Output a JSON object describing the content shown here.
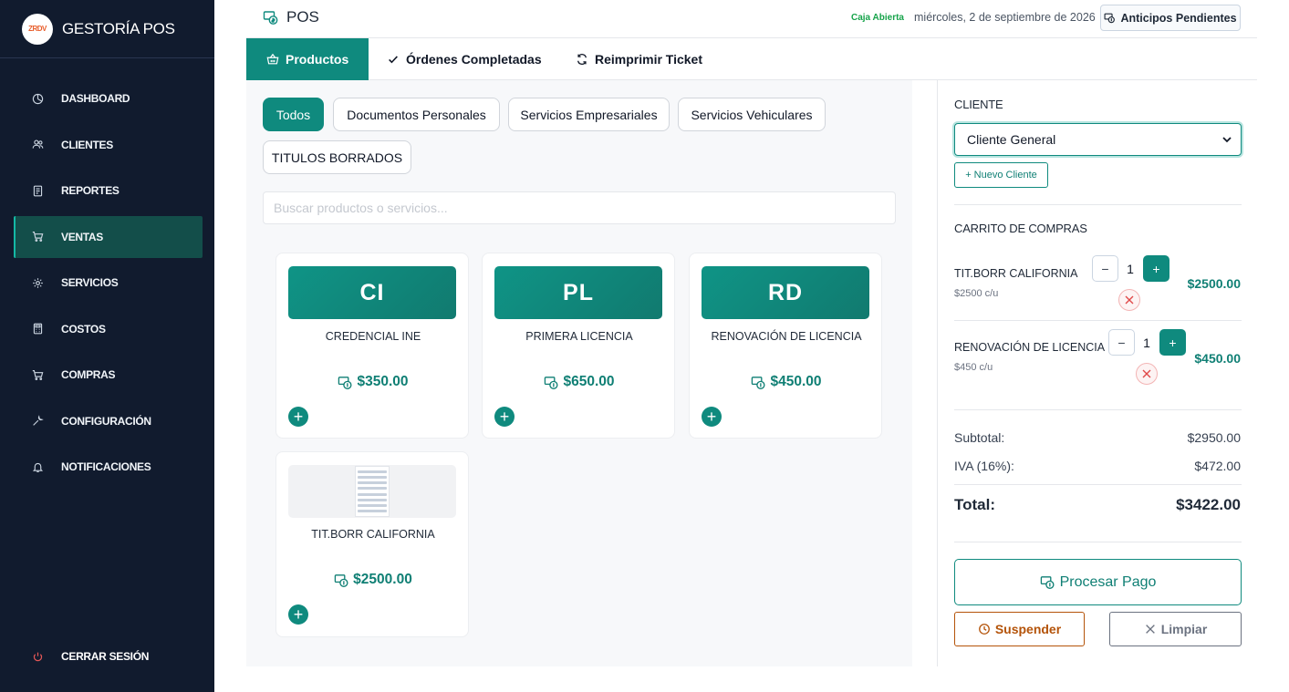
{
  "sidebar": {
    "brand": "GESTORÍA POS",
    "logo_text": "ZRDV",
    "items": [
      {
        "label": "DASHBOARD",
        "icon": "dashboard-icon"
      },
      {
        "label": "CLIENTES",
        "icon": "users-icon"
      },
      {
        "label": "REPORTES",
        "icon": "report-icon"
      },
      {
        "label": "VENTAS",
        "icon": "cart-icon",
        "active": true
      },
      {
        "label": "SERVICIOS",
        "icon": "gear-icon"
      },
      {
        "label": "COSTOS",
        "icon": "calculator-icon"
      },
      {
        "label": "COMPRAS",
        "icon": "cart-icon"
      },
      {
        "label": "CONFIGURACIÓN",
        "icon": "wrench-icon"
      },
      {
        "label": "NOTIFICACIONES",
        "icon": "bell-icon"
      }
    ],
    "logout": "CERRAR SESIÓN"
  },
  "topbar": {
    "title": "POS",
    "status": "Caja Abierta",
    "date": "miércoles, 2 de septiembre de 2026",
    "anticipos": "Anticipos Pendientes"
  },
  "tabs": [
    "Productos",
    "Órdenes Completadas",
    "Reimprimir Ticket"
  ],
  "filters": [
    "Todos",
    "Documentos Personales",
    "Servicios Empresariales",
    "Servicios Vehiculares",
    "TITULOS BORRADOS"
  ],
  "search": {
    "placeholder": "Buscar productos o servicios..."
  },
  "products": [
    {
      "code": "CI",
      "name": "CREDENCIAL INE",
      "price": "$350.00"
    },
    {
      "code": "PL",
      "name": "PRIMERA LICENCIA",
      "price": "$650.00"
    },
    {
      "code": "RD",
      "name": "RENOVACIÓN DE LICENCIA",
      "price": "$450.00"
    },
    {
      "code": "",
      "name": "TIT.BORR CALIFORNIA",
      "price": "$2500.00"
    }
  ],
  "client": {
    "label": "CLIENTE",
    "selected": "Cliente General",
    "new_button": "+ Nuevo Cliente"
  },
  "cart": {
    "label": "CARRITO DE COMPRAS",
    "items": [
      {
        "name": "TIT.BORR CALIFORNIA",
        "unit": "$2500 c/u",
        "qty": "1",
        "total": "$2500.00"
      },
      {
        "name": "RENOVACIÓN DE LICENCIA",
        "unit": "$450 c/u",
        "qty": "1",
        "total": "$450.00"
      }
    ],
    "subtotal_label": "Subtotal:",
    "subtotal": "$2950.00",
    "iva_label": "IVA (16%):",
    "iva": "$472.00",
    "total_label": "Total:",
    "total": "$3422.00"
  },
  "actions": {
    "procesar": "Procesar Pago",
    "suspender": "Suspender",
    "limpiar": "Limpiar"
  },
  "colors": {
    "accent": "#0f8a7e",
    "sidebar": "#111b2e",
    "status": "#16a34a",
    "warning": "#b45309"
  }
}
